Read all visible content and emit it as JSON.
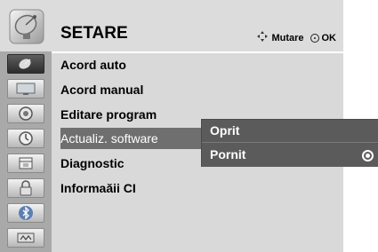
{
  "header": {
    "title": "SETARE",
    "move_hint": "Mutare",
    "ok_hint": "OK",
    "icon": "satellite-dish-icon"
  },
  "sidebar": {
    "items": [
      {
        "icon": "satellite-dish-icon",
        "active": true
      },
      {
        "icon": "tv-picture-icon",
        "active": false
      },
      {
        "icon": "speaker-icon",
        "active": false
      },
      {
        "icon": "clock-icon",
        "active": false
      },
      {
        "icon": "calendar-icon",
        "active": false
      },
      {
        "icon": "lock-icon",
        "active": false
      },
      {
        "icon": "bluetooth-icon",
        "active": false
      },
      {
        "icon": "usb-icon",
        "active": false
      }
    ]
  },
  "menu": {
    "items": [
      {
        "label": "Acord auto"
      },
      {
        "label": "Acord manual"
      },
      {
        "label": "Editare program"
      },
      {
        "label": "Actualiz. software",
        "selected": true
      },
      {
        "label": "Diagnostic"
      },
      {
        "label": "Informaăii CI"
      }
    ]
  },
  "submenu": {
    "options": [
      {
        "label": "Oprit",
        "checked": false
      },
      {
        "label": "Pornit",
        "checked": true
      }
    ]
  },
  "colors": {
    "panel": "#d9d9d9",
    "sidebar": "#a9a9a9",
    "highlight": "#6f6f6f",
    "submenu": "#5b5b5b"
  }
}
